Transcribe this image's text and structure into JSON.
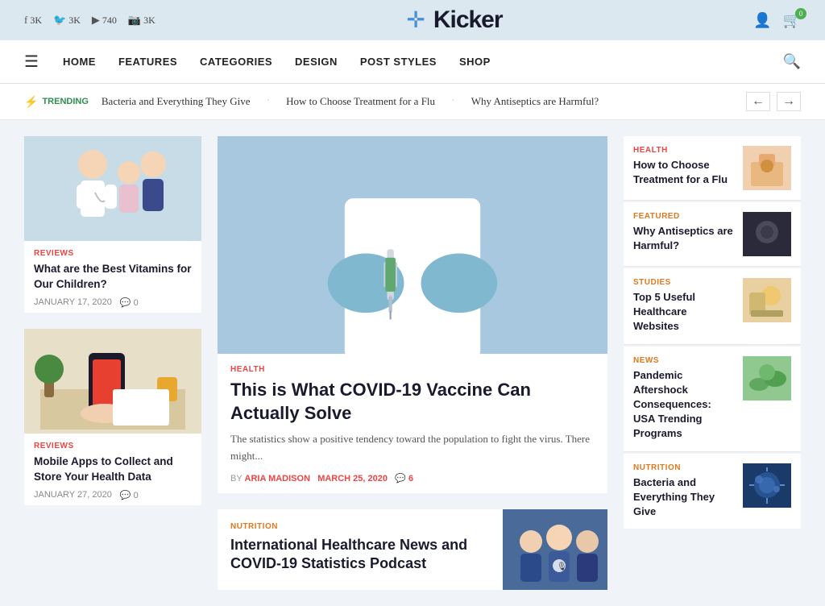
{
  "topBar": {
    "social": [
      {
        "icon": "f",
        "label": "3K",
        "name": "facebook"
      },
      {
        "icon": "🐦",
        "label": "3K",
        "name": "twitter"
      },
      {
        "icon": "▶",
        "label": "740",
        "name": "youtube"
      },
      {
        "icon": "📷",
        "label": "3K",
        "name": "instagram"
      }
    ]
  },
  "logo": {
    "symbol": "✛",
    "name": "Kicker"
  },
  "nav": {
    "hamburger": "☰",
    "links": [
      "HOME",
      "FEATURES",
      "CATEGORIES",
      "DESIGN",
      "POST STYLES",
      "SHOP"
    ],
    "search": "🔍"
  },
  "trending": {
    "label": "TRENDING",
    "items": [
      "Bacteria and Everything They Give",
      "How to Choose Treatment for a Flu",
      "Why Antiseptics are Harmful?"
    ]
  },
  "leftCol": {
    "articles": [
      {
        "category": "REVIEWS",
        "catClass": "cat-reviews",
        "title": "What are the Best Vitamins for Our Children?",
        "date": "JANUARY 17, 2020",
        "comments": "0",
        "figure": "fig-doctor"
      },
      {
        "category": "REVIEWS",
        "catClass": "cat-reviews",
        "title": "Mobile Apps to Collect and Store Your Health Data",
        "date": "JANUARY 27, 2020",
        "comments": "0",
        "figure": "fig-phone"
      }
    ]
  },
  "centerCol": {
    "featured": {
      "category": "HEALTH",
      "catClass": "cat-health",
      "title": "This is What COVID-19 Vaccine Can Actually Solve",
      "excerpt": "The statistics show a positive tendency toward the population to fight the virus. There might...",
      "author": "ARIA MADISON",
      "date": "MARCH 25, 2020",
      "comments": "6",
      "figure": "fig-needle"
    },
    "second": {
      "category": "NUTRITION",
      "catClass": "cat-nutrition",
      "title": "International Healthcare News and COVID-19 Statistics Podcast",
      "figure": "fig-team"
    }
  },
  "rightCol": {
    "items": [
      {
        "category": "HEALTH",
        "catClass": "cat-health",
        "title": "How to Choose Treatment for a Flu",
        "figure": "fig-medical"
      },
      {
        "category": "FEATURED",
        "catClass": "cat-featured",
        "title": "Why Antiseptics are Harmful?",
        "figure": "fig-dark"
      },
      {
        "category": "STUDIES",
        "catClass": "cat-studies",
        "title": "Top 5 Useful Healthcare Websites",
        "figure": "fig-laptop"
      },
      {
        "category": "NEWS",
        "catClass": "cat-news",
        "title": "Pandemic Aftershock Consequences: USA Trending Programs",
        "figure": "fig-green"
      },
      {
        "category": "NUTRITION",
        "catClass": "cat-nutrition",
        "title": "Bacteria and Everything They Give",
        "figure": "fig-blue-virus"
      }
    ]
  }
}
